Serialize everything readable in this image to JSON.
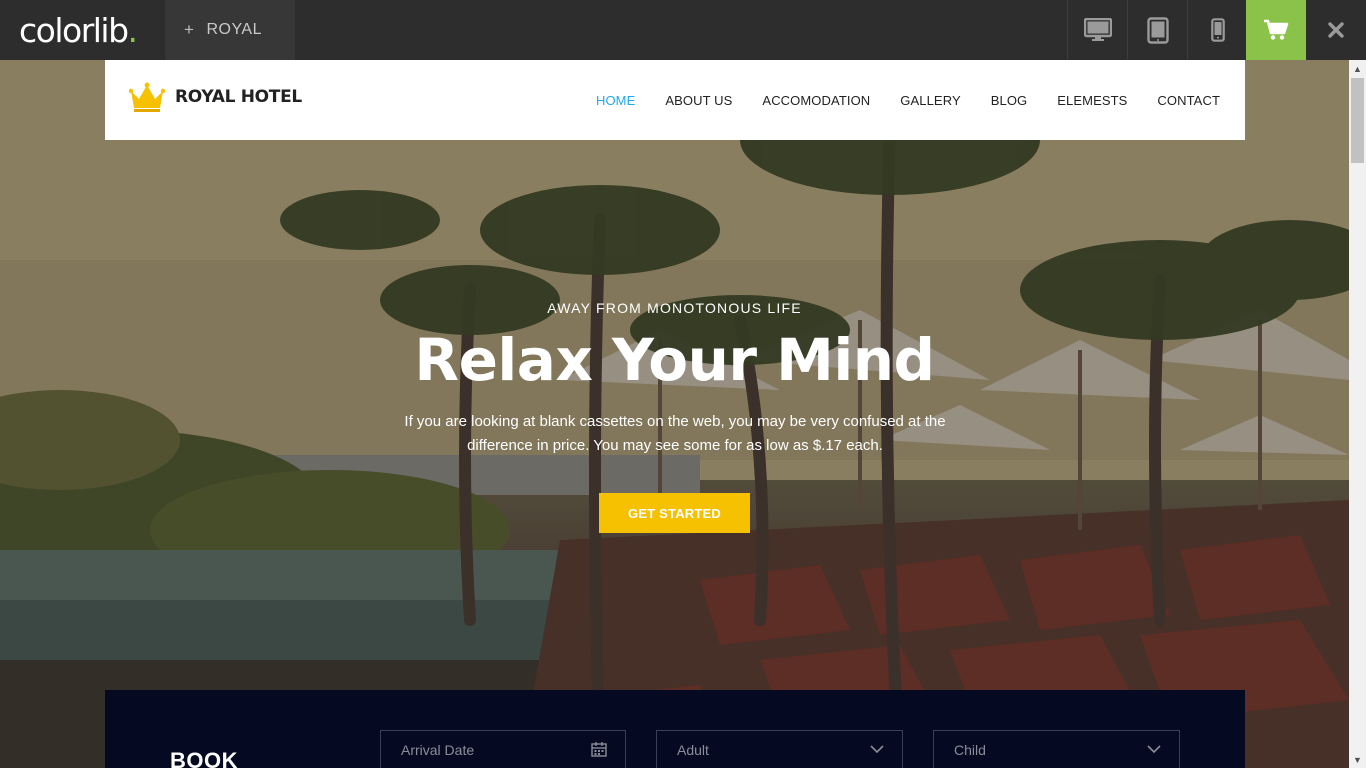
{
  "topbar": {
    "brand": "colorlib",
    "brand_dot": ".",
    "template_tab": "ROYAL",
    "icons": [
      "desktop-icon",
      "tablet-icon",
      "mobile-icon",
      "cart-icon",
      "close-icon"
    ],
    "accent": "#8bc34a"
  },
  "header": {
    "logo_text": "ROYAL HOTEL",
    "nav": [
      {
        "label": "HOME",
        "active": true
      },
      {
        "label": "ABOUT US"
      },
      {
        "label": "ACCOMODATION"
      },
      {
        "label": "GALLERY"
      },
      {
        "label": "BLOG"
      },
      {
        "label": "ELEMESTS"
      },
      {
        "label": "CONTACT"
      }
    ],
    "active_color": "#21a9e8"
  },
  "hero": {
    "kicker": "AWAY FROM MONOTONOUS LIFE",
    "headline": "Relax Your Mind",
    "description": "If you are looking at blank cassettes on the web, you may be very confused at the difference in price. You may see some for as low as $.17 each.",
    "cta": "GET STARTED",
    "cta_color": "#f5c100"
  },
  "booking": {
    "title": "BOOK",
    "arrival_placeholder": "Arrival Date",
    "adult_label": "Adult",
    "child_label": "Child",
    "background": "#050a22"
  }
}
